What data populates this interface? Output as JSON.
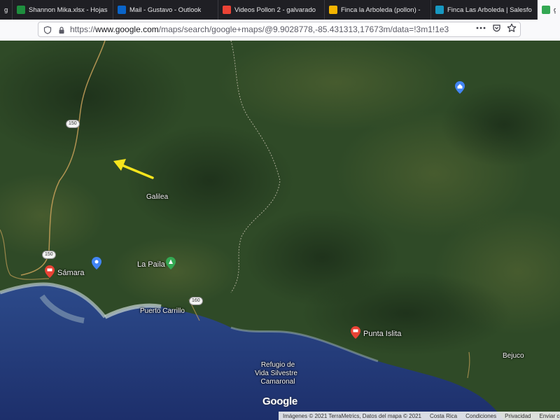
{
  "tabs": [
    {
      "label": "g",
      "icon": "generic-tab-icon",
      "color": "#555555"
    },
    {
      "label": "Shannon Mika.xlsx - Hojas de",
      "icon": "sheets-icon",
      "color": "#1e8e3e"
    },
    {
      "label": "Mail - Gustavo - Outlook",
      "icon": "outlook-icon",
      "color": "#0a64c8"
    },
    {
      "label": "Videos Pollon 2 - galvarado",
      "icon": "gmail-icon",
      "color": "#ea4335"
    },
    {
      "label": "Finca la Arboleda (pollon) -",
      "icon": "drive-icon",
      "color": "#f4b400"
    },
    {
      "label": "Finca Las Arboleda | Salesfo",
      "icon": "salesforce-icon",
      "color": "#1798c1"
    },
    {
      "label": "goo",
      "icon": "maps-icon",
      "color": "#34a853"
    }
  ],
  "url": {
    "domain": "www.google.com",
    "prefix": "https://",
    "path": "/maps/search/google+maps/@9.9028778,-85.431313,17673m/data=!3m1!1e3"
  },
  "icons": {
    "shield": "shield-icon",
    "lock": "lock-icon",
    "more": "more-icon",
    "pocket": "pocket-icon",
    "bookmark": "star-icon"
  },
  "map": {
    "places": {
      "galilea": "Galilea",
      "samara": "Sámara",
      "la_paila": "La Paila",
      "puerto_carrillo": "Puerto Carrillo",
      "punta_islita": "Punta Islita",
      "bejuco": "Bejuco",
      "refugio": [
        "Refugio de",
        "Vida Silvestre",
        "Camaronal"
      ]
    },
    "routes": {
      "r150a": "150",
      "r150b": "150",
      "r160": "160"
    },
    "logo": "Google",
    "footer": {
      "imagery": "Imágenes © 2021 TerraMetrics, Datos del mapa © 2021",
      "country": "Costa Rica",
      "terms": "Condiciones",
      "privacy": "Privacidad",
      "send": "Enviar com"
    },
    "colors": {
      "pin_red": "#e94235",
      "pin_blue": "#4285f4",
      "pin_green": "#34a853",
      "arrow": "#f6e51d"
    }
  }
}
